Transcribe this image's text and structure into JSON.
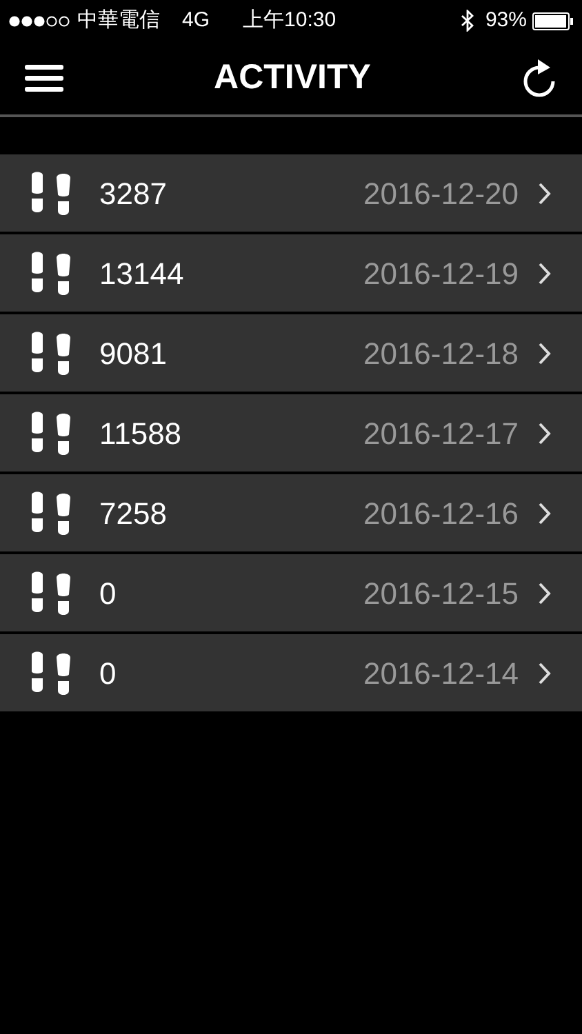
{
  "status_bar": {
    "carrier": "中華電信",
    "network": "4G",
    "time": "上午10:30",
    "battery": "93%"
  },
  "nav_bar": {
    "title": "ACTIVITY"
  },
  "entries": [
    {
      "steps": "3287",
      "date": "2016-12-20"
    },
    {
      "steps": "13144",
      "date": "2016-12-19"
    },
    {
      "steps": "9081",
      "date": "2016-12-18"
    },
    {
      "steps": "11588",
      "date": "2016-12-17"
    },
    {
      "steps": "7258",
      "date": "2016-12-16"
    },
    {
      "steps": "0",
      "date": "2016-12-15"
    },
    {
      "steps": "0",
      "date": "2016-12-14"
    }
  ]
}
